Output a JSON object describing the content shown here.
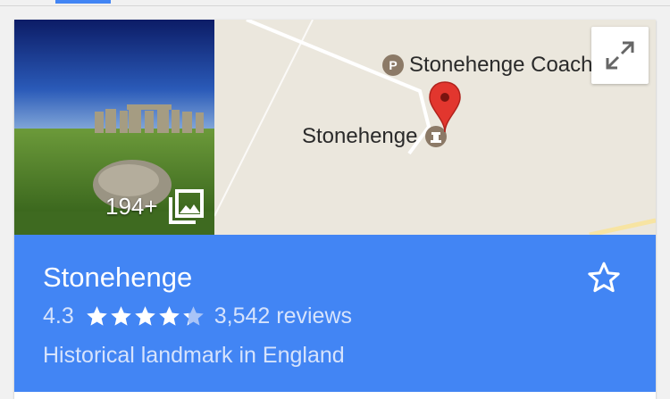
{
  "photo": {
    "count_label": "194+",
    "icon": "photo-library-icon"
  },
  "map": {
    "poi_coach_letter": "P",
    "poi_coach_label": "Stonehenge Coach Park",
    "poi_stone_label": "Stonehenge",
    "expand_icon": "expand-icon"
  },
  "place": {
    "title": "Stonehenge",
    "rating": "4.3",
    "rating_value": 4.3,
    "rating_max": 5,
    "reviews": "3,542 reviews",
    "category": "Historical landmark in England",
    "save_icon": "star-outline-icon"
  },
  "colors": {
    "accent": "#4285f4",
    "map_bg": "#ebe7dd",
    "pin": "#e2362e",
    "poi": "#8c7a67"
  }
}
